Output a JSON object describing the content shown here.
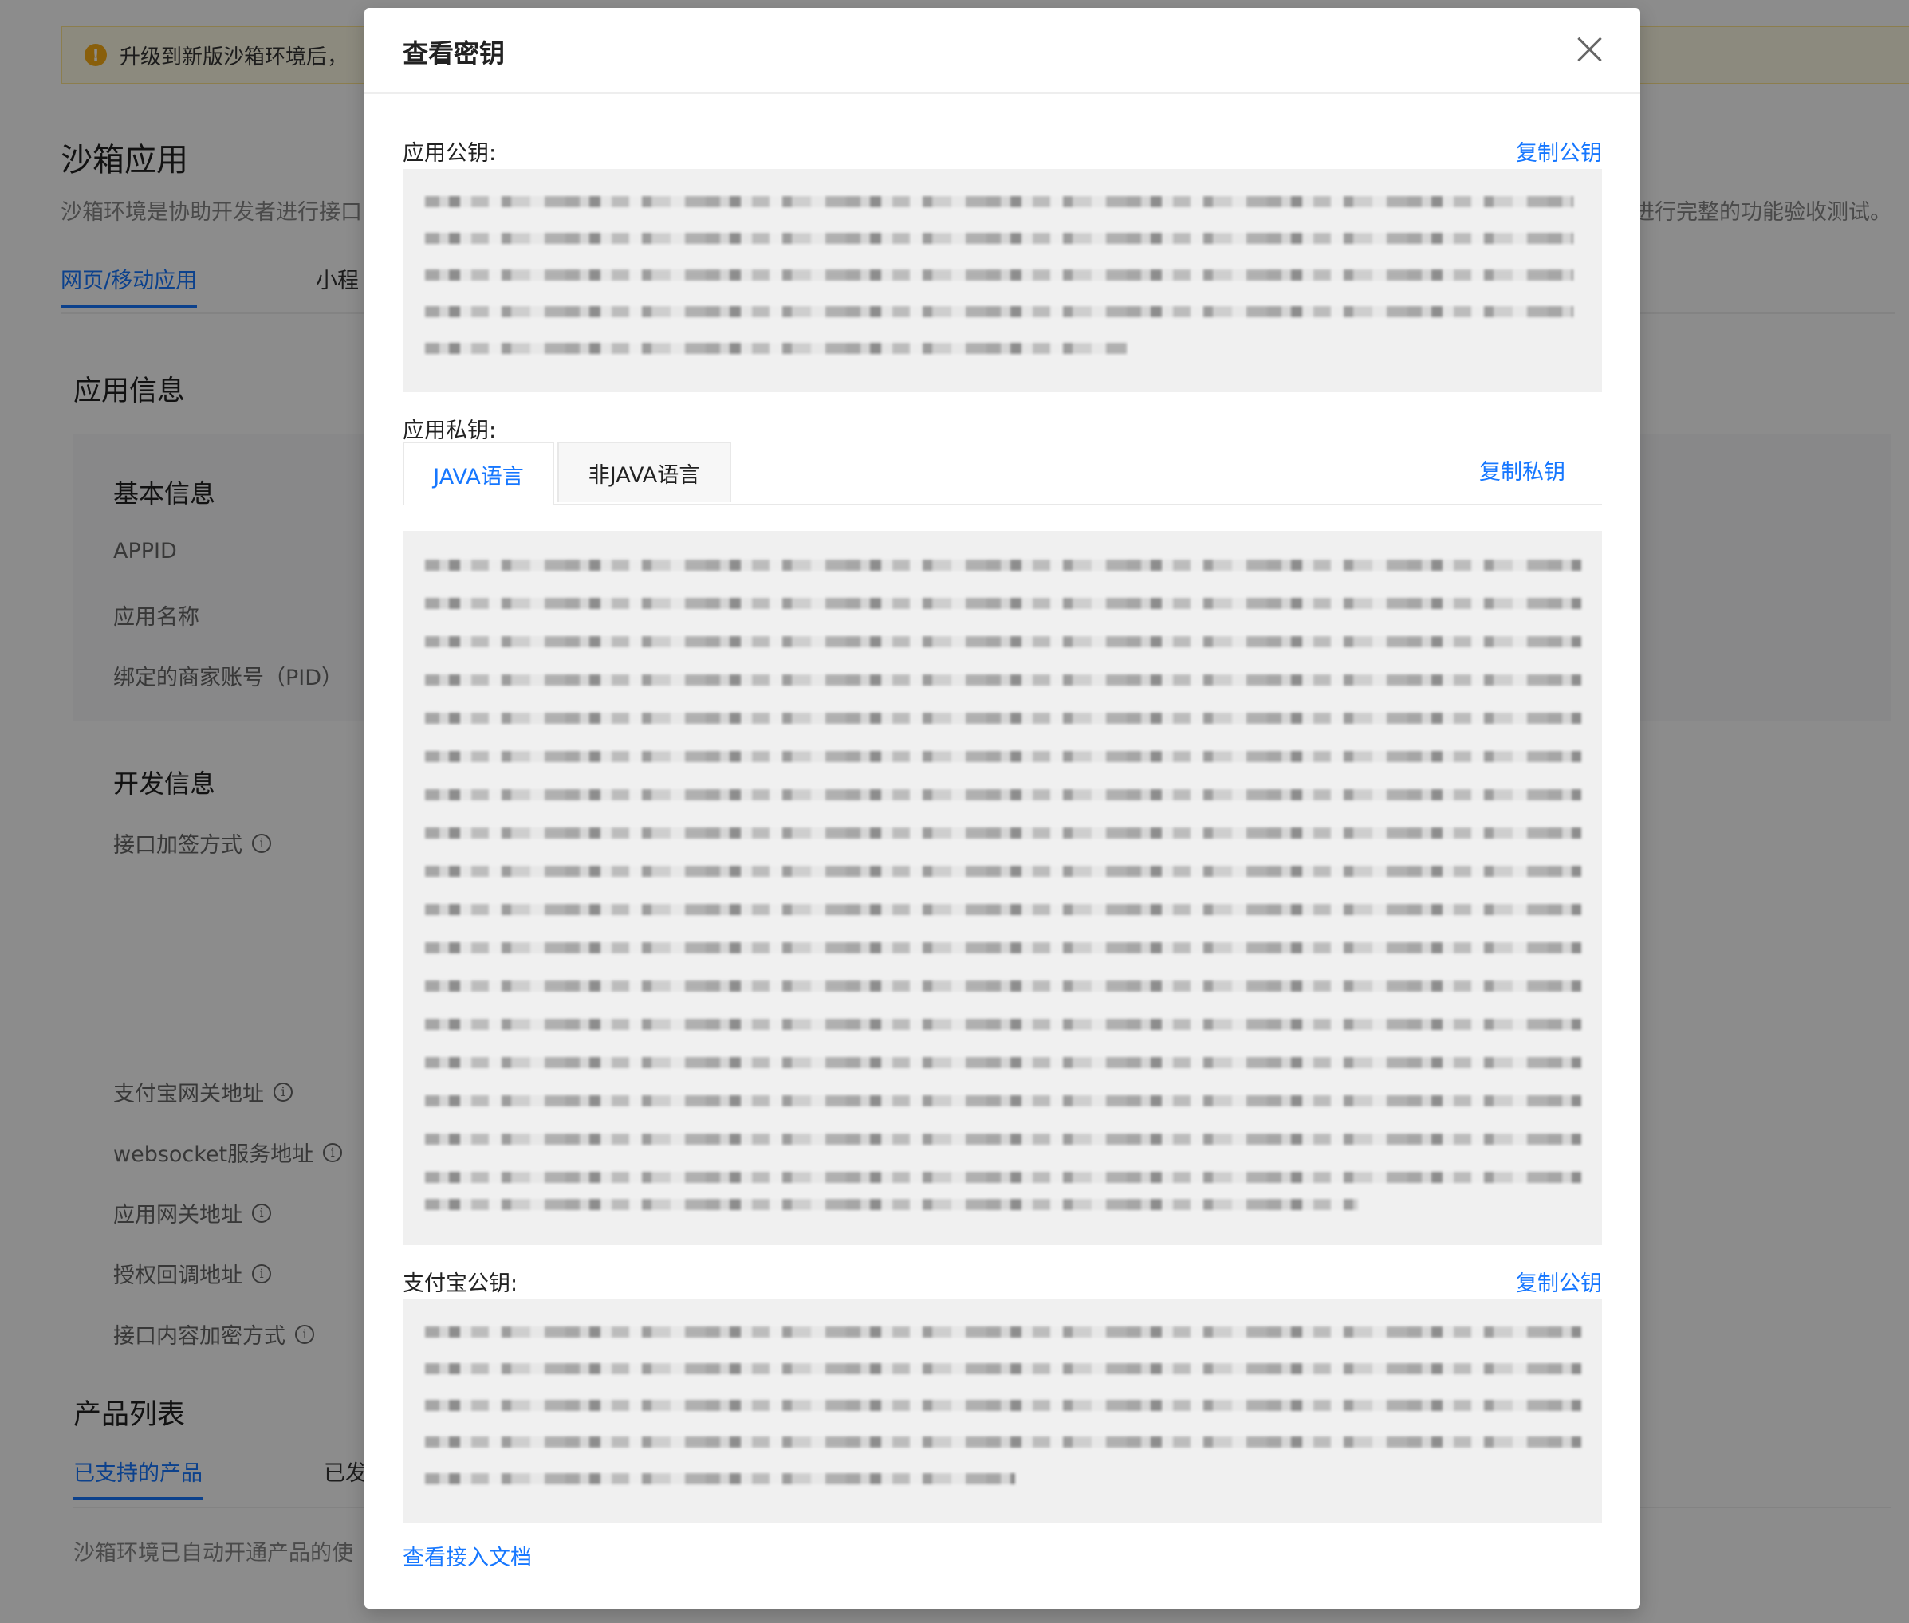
{
  "background": {
    "notice_text": "升级到新版沙箱环境后，",
    "title": "沙箱应用",
    "description_left": "沙箱环境是协助开发者进行接口",
    "description_right": "进行完整的功能验收测试。",
    "tabs": [
      "网页/移动应用",
      "小程"
    ],
    "app_info_title": "应用信息",
    "basic_info": {
      "title": "基本信息",
      "fields": [
        "APPID",
        "应用名称",
        "绑定的商家账号（PID）"
      ]
    },
    "dev_info": {
      "title": "开发信息",
      "fields": [
        "接口加签方式",
        "支付宝网关地址",
        "websocket服务地址",
        "应用网关地址",
        "授权回调地址",
        "接口内容加密方式"
      ]
    },
    "product_list": {
      "title": "产品列表",
      "tabs": [
        "已支持的产品",
        "已发"
      ],
      "description": "沙箱环境已自动开通产品的使"
    }
  },
  "modal": {
    "title": "查看密钥",
    "app_public_key": {
      "label": "应用公钥:",
      "copy_label": "复制公钥"
    },
    "app_private_key": {
      "label": "应用私钥:",
      "copy_label": "复制私钥",
      "tabs": [
        "JAVA语言",
        "非JAVA语言"
      ],
      "active_tab": "JAVA语言"
    },
    "alipay_public_key": {
      "label": "支付宝公钥:",
      "copy_label": "复制公钥"
    },
    "doc_link": "查看接入文档"
  },
  "colors": {
    "accent": "#1677ff",
    "notice_bg": "#fffbe6",
    "notice_border": "#ffe58f",
    "warning_icon": "#faad14",
    "key_box_bg": "#f0f0f0"
  },
  "icons": {
    "warning": "exclamation-circle-icon",
    "close": "close-icon",
    "info": "info-circle-icon"
  }
}
